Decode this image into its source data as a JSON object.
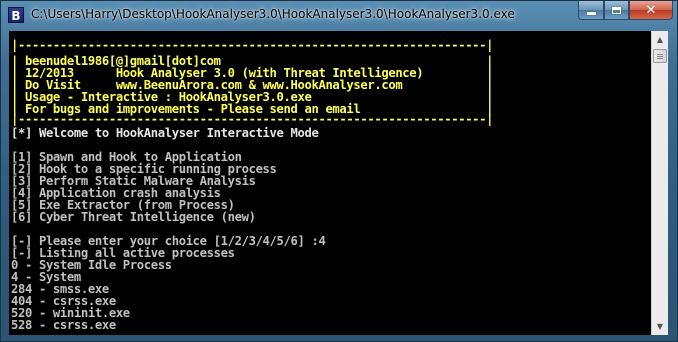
{
  "window": {
    "title": "C:\\Users\\Harry\\Desktop\\HookAnalyser3.0\\HookAnalyser3.0\\HookAnalyser3.0.exe",
    "icon_letter": "B",
    "icon": "console-app-icon"
  },
  "caption_buttons": {
    "minimize": "minimize-icon",
    "maximize": "maximize-icon",
    "close_label": "✕"
  },
  "console": {
    "banner": [
      "|-------------------------------------------------------------------|",
      "| beenudel1986[@]gmail[dot]com                                      |",
      "| 12/2013      Hook Analyser 3.0 (with Threat Intelligence)         |",
      "| Do Visit     www.BeenuArora.com & www.HookAnalyser.com            |",
      "| Usage - Interactive : HookAnalyser3.0.exe                         |",
      "| For bugs and improvements - Please send an email                  |",
      "|-------------------------------------------------------------------|"
    ],
    "welcome": "[*] Welcome to HookAnalyser Interactive Mode",
    "menu": [
      "[1] Spawn and Hook to Application",
      "[2] Hook to a specific running process",
      "[3] Perform Static Malware Analysis",
      "[4] Application crash analysis",
      "[5] Exe Extractor (from Process)",
      "[6] Cyber Threat Intelligence (new)"
    ],
    "prompt": "[-] Please enter your choice [1/2/3/4/5/6] :4",
    "listing": "[-] Listing all active processes",
    "processes": [
      "0 - System Idle Process",
      "4 - System",
      "284 - smss.exe",
      "404 - csrss.exe",
      "520 - wininit.exe",
      "528 - csrss.exe"
    ]
  },
  "colors": {
    "console_bg": "#000000",
    "banner_text": "#ffff55",
    "body_text": "#c0c0c0"
  }
}
